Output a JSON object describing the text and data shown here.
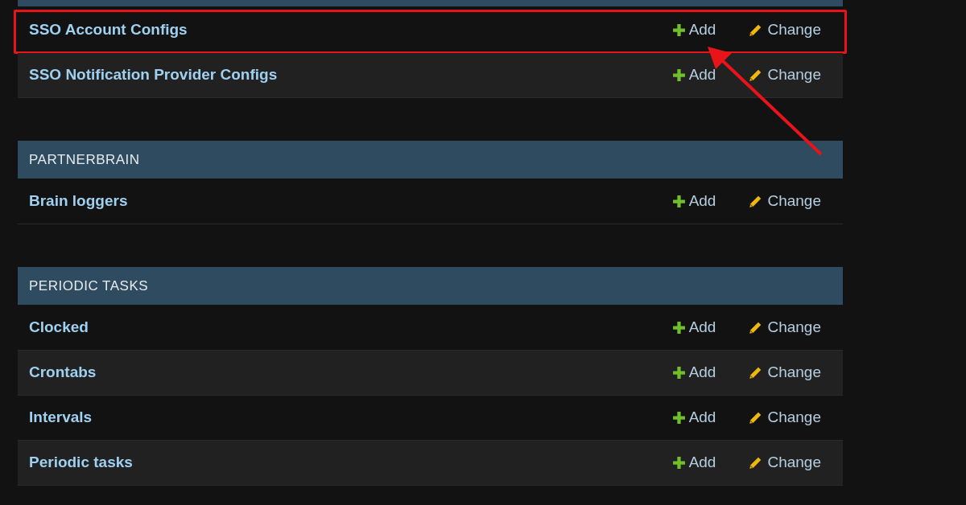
{
  "sections": [
    {
      "models": [
        {
          "name": "SSO Account Configs",
          "add": "Add",
          "change": "Change",
          "highlighted": true
        },
        {
          "name": "SSO Notification Provider Configs",
          "add": "Add",
          "change": "Change",
          "highlighted": false
        }
      ]
    },
    {
      "title": "PARTNERBRAIN",
      "models": [
        {
          "name": "Brain loggers",
          "add": "Add",
          "change": "Change",
          "highlighted": false
        }
      ]
    },
    {
      "title": "PERIODIC TASKS",
      "models": [
        {
          "name": "Clocked",
          "add": "Add",
          "change": "Change",
          "highlighted": false
        },
        {
          "name": "Crontabs",
          "add": "Add",
          "change": "Change",
          "highlighted": false
        },
        {
          "name": "Intervals",
          "add": "Add",
          "change": "Change",
          "highlighted": false
        },
        {
          "name": "Periodic tasks",
          "add": "Add",
          "change": "Change",
          "highlighted": false
        }
      ]
    }
  ]
}
